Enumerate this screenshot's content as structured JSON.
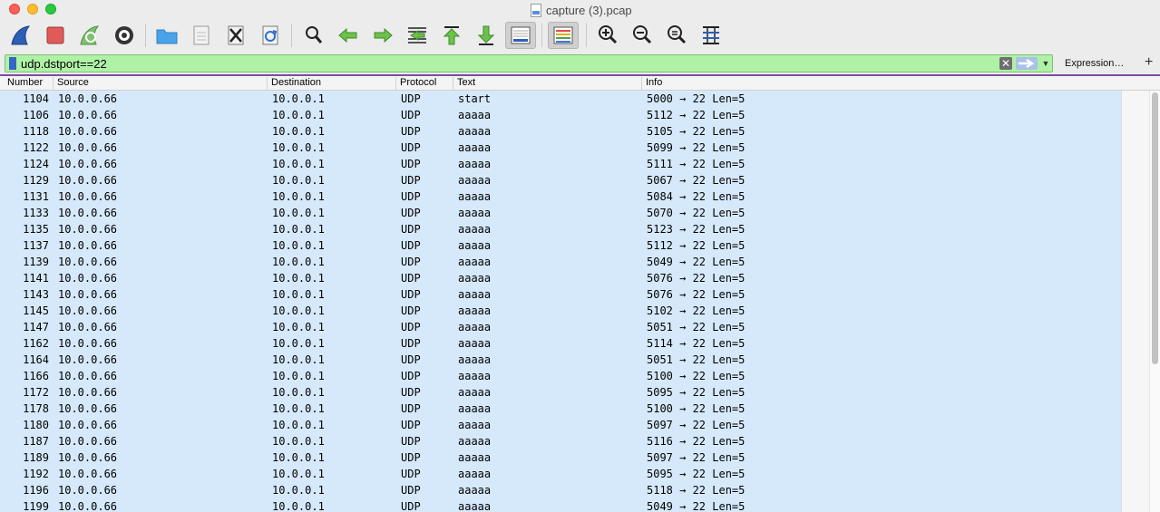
{
  "window": {
    "title": "capture (3).pcap"
  },
  "toolbar": {
    "buttons": [
      "start-capture-icon",
      "stop-capture-icon",
      "restart-capture-icon",
      "capture-options-icon",
      "open-file-icon",
      "save-file-icon",
      "close-file-icon",
      "reload-file-icon",
      "find-packet-icon",
      "go-back-icon",
      "go-forward-icon",
      "go-to-packet-icon",
      "first-packet-icon",
      "last-packet-icon",
      "auto-scroll-icon",
      "colorize-icon",
      "zoom-in-icon",
      "zoom-out-icon",
      "normal-size-icon",
      "resize-columns-icon"
    ]
  },
  "filter": {
    "value": "udp.dstport==22",
    "expression_label": "Expression…",
    "plus_label": "+",
    "background_color": "#aff2a6"
  },
  "columns": {
    "number": "Number",
    "source": "Source",
    "destination": "Destination",
    "protocol": "Protocol",
    "text": "Text",
    "info": "Info"
  },
  "packets": [
    {
      "number": "1104",
      "source": "10.0.0.66",
      "destination": "10.0.0.1",
      "protocol": "UDP",
      "text": "start",
      "info": "5000 → 22 Len=5"
    },
    {
      "number": "1106",
      "source": "10.0.0.66",
      "destination": "10.0.0.1",
      "protocol": "UDP",
      "text": "aaaaa",
      "info": "5112 → 22 Len=5"
    },
    {
      "number": "1118",
      "source": "10.0.0.66",
      "destination": "10.0.0.1",
      "protocol": "UDP",
      "text": "aaaaa",
      "info": "5105 → 22 Len=5"
    },
    {
      "number": "1122",
      "source": "10.0.0.66",
      "destination": "10.0.0.1",
      "protocol": "UDP",
      "text": "aaaaa",
      "info": "5099 → 22 Len=5"
    },
    {
      "number": "1124",
      "source": "10.0.0.66",
      "destination": "10.0.0.1",
      "protocol": "UDP",
      "text": "aaaaa",
      "info": "5111 → 22 Len=5"
    },
    {
      "number": "1129",
      "source": "10.0.0.66",
      "destination": "10.0.0.1",
      "protocol": "UDP",
      "text": "aaaaa",
      "info": "5067 → 22 Len=5"
    },
    {
      "number": "1131",
      "source": "10.0.0.66",
      "destination": "10.0.0.1",
      "protocol": "UDP",
      "text": "aaaaa",
      "info": "5084 → 22 Len=5"
    },
    {
      "number": "1133",
      "source": "10.0.0.66",
      "destination": "10.0.0.1",
      "protocol": "UDP",
      "text": "aaaaa",
      "info": "5070 → 22 Len=5"
    },
    {
      "number": "1135",
      "source": "10.0.0.66",
      "destination": "10.0.0.1",
      "protocol": "UDP",
      "text": "aaaaa",
      "info": "5123 → 22 Len=5"
    },
    {
      "number": "1137",
      "source": "10.0.0.66",
      "destination": "10.0.0.1",
      "protocol": "UDP",
      "text": "aaaaa",
      "info": "5112 → 22 Len=5"
    },
    {
      "number": "1139",
      "source": "10.0.0.66",
      "destination": "10.0.0.1",
      "protocol": "UDP",
      "text": "aaaaa",
      "info": "5049 → 22 Len=5"
    },
    {
      "number": "1141",
      "source": "10.0.0.66",
      "destination": "10.0.0.1",
      "protocol": "UDP",
      "text": "aaaaa",
      "info": "5076 → 22 Len=5"
    },
    {
      "number": "1143",
      "source": "10.0.0.66",
      "destination": "10.0.0.1",
      "protocol": "UDP",
      "text": "aaaaa",
      "info": "5076 → 22 Len=5"
    },
    {
      "number": "1145",
      "source": "10.0.0.66",
      "destination": "10.0.0.1",
      "protocol": "UDP",
      "text": "aaaaa",
      "info": "5102 → 22 Len=5"
    },
    {
      "number": "1147",
      "source": "10.0.0.66",
      "destination": "10.0.0.1",
      "protocol": "UDP",
      "text": "aaaaa",
      "info": "5051 → 22 Len=5"
    },
    {
      "number": "1162",
      "source": "10.0.0.66",
      "destination": "10.0.0.1",
      "protocol": "UDP",
      "text": "aaaaa",
      "info": "5114 → 22 Len=5"
    },
    {
      "number": "1164",
      "source": "10.0.0.66",
      "destination": "10.0.0.1",
      "protocol": "UDP",
      "text": "aaaaa",
      "info": "5051 → 22 Len=5"
    },
    {
      "number": "1166",
      "source": "10.0.0.66",
      "destination": "10.0.0.1",
      "protocol": "UDP",
      "text": "aaaaa",
      "info": "5100 → 22 Len=5"
    },
    {
      "number": "1172",
      "source": "10.0.0.66",
      "destination": "10.0.0.1",
      "protocol": "UDP",
      "text": "aaaaa",
      "info": "5095 → 22 Len=5"
    },
    {
      "number": "1178",
      "source": "10.0.0.66",
      "destination": "10.0.0.1",
      "protocol": "UDP",
      "text": "aaaaa",
      "info": "5100 → 22 Len=5"
    },
    {
      "number": "1180",
      "source": "10.0.0.66",
      "destination": "10.0.0.1",
      "protocol": "UDP",
      "text": "aaaaa",
      "info": "5097 → 22 Len=5"
    },
    {
      "number": "1187",
      "source": "10.0.0.66",
      "destination": "10.0.0.1",
      "protocol": "UDP",
      "text": "aaaaa",
      "info": "5116 → 22 Len=5"
    },
    {
      "number": "1189",
      "source": "10.0.0.66",
      "destination": "10.0.0.1",
      "protocol": "UDP",
      "text": "aaaaa",
      "info": "5097 → 22 Len=5"
    },
    {
      "number": "1192",
      "source": "10.0.0.66",
      "destination": "10.0.0.1",
      "protocol": "UDP",
      "text": "aaaaa",
      "info": "5095 → 22 Len=5"
    },
    {
      "number": "1196",
      "source": "10.0.0.66",
      "destination": "10.0.0.1",
      "protocol": "UDP",
      "text": "aaaaa",
      "info": "5118 → 22 Len=5"
    },
    {
      "number": "1199",
      "source": "10.0.0.66",
      "destination": "10.0.0.1",
      "protocol": "UDP",
      "text": "aaaaa",
      "info": "5049 → 22 Len=5"
    }
  ],
  "colors": {
    "row_background": "#d6e9fb",
    "filter_valid": "#aff2a6",
    "accent_line": "#7c4d9e"
  }
}
